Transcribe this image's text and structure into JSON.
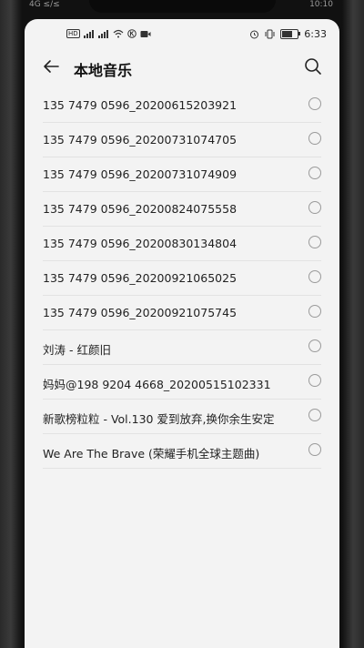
{
  "outer_status": {
    "left": "4G  ≤/≤",
    "right": "10:10"
  },
  "status_bar": {
    "hd_label": "HD",
    "time": "6:33",
    "icons": [
      "hd-icon",
      "signal-icon",
      "signal-icon",
      "wifi-icon",
      "k-icon",
      "video-icon",
      "alarm-icon",
      "vibrate-icon",
      "battery-icon"
    ]
  },
  "app_bar": {
    "title": "本地音乐",
    "back_icon": "back-arrow-icon",
    "search_icon": "search-icon"
  },
  "songs": [
    {
      "name": "135 7479 0596_20200615203921"
    },
    {
      "name": "135 7479 0596_20200731074705"
    },
    {
      "name": "135 7479 0596_20200731074909"
    },
    {
      "name": "135 7479 0596_20200824075558"
    },
    {
      "name": "135 7479 0596_20200830134804"
    },
    {
      "name": "135 7479 0596_20200921065025"
    },
    {
      "name": "135 7479 0596_20200921075745"
    },
    {
      "name": "刘涛 - 红颜旧"
    },
    {
      "name": "妈妈@198 9204 4668_20200515102331"
    },
    {
      "name": "新歌榜粒粒 - Vol.130 爱到放弃,换你余生安定"
    },
    {
      "name": "We Are The Brave (荣耀手机全球主题曲)"
    }
  ],
  "colors": {
    "screen_bg": "#f3f3f3",
    "text": "#222222",
    "divider": "#e2e2e2",
    "radio_border": "#9a9a9a"
  }
}
